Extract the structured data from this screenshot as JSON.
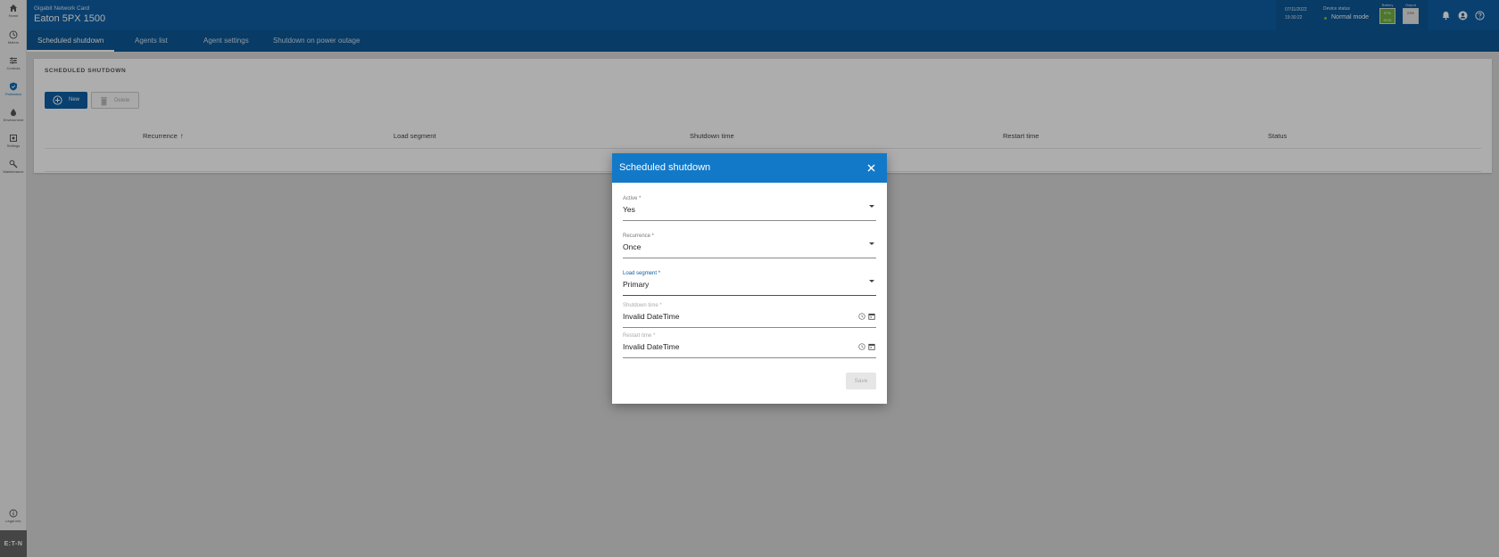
{
  "sidebar": {
    "items": [
      {
        "label": "Home",
        "icon": "home-icon"
      },
      {
        "label": "Meters",
        "icon": "meters-icon"
      },
      {
        "label": "Controls",
        "icon": "controls-icon"
      },
      {
        "label": "Protection",
        "icon": "protection-icon",
        "active": true
      },
      {
        "label": "Environment",
        "icon": "environment-icon"
      },
      {
        "label": "Settings",
        "icon": "settings-icon"
      },
      {
        "label": "Maintenance",
        "icon": "maintenance-icon"
      }
    ],
    "legal": {
      "label": "Legal info",
      "icon": "info-icon"
    },
    "brand": "E:T-N"
  },
  "header": {
    "subtitle": "Gigabit Network Card",
    "title": "Eaton 5PX 1500",
    "date": "07/11/2022",
    "time": "19:30:22",
    "device_status_label": "Device status",
    "device_status_value": "Normal mode",
    "battery": {
      "label": "Battery",
      "value": "97%",
      "sub": "00:20"
    },
    "output": {
      "label": "Output",
      "value": "23%"
    }
  },
  "tabs": [
    {
      "label": "Scheduled shutdown",
      "active": true
    },
    {
      "label": "Agents list"
    },
    {
      "label": "Agent settings"
    },
    {
      "label": "Shutdown on power outage"
    }
  ],
  "card": {
    "title": "SCHEDULED SHUTDOWN",
    "new_label": "New",
    "delete_label": "Delete",
    "columns": [
      "Recurrence",
      "Load segment",
      "Shutdown time",
      "Restart time",
      "Status"
    ],
    "sort_arrow": "↑"
  },
  "dialog": {
    "title": "Scheduled shutdown",
    "fields": {
      "active": {
        "label": "Active *",
        "value": "Yes"
      },
      "recurrence": {
        "label": "Recurrence *",
        "value": "Once"
      },
      "load_segment": {
        "label": "Load segment *",
        "value": "Primary"
      },
      "shutdown_time": {
        "label": "Shutdown time *",
        "value": "Invalid DateTime"
      },
      "restart_time": {
        "label": "Restart time *",
        "value": "Invalid DateTime"
      }
    },
    "save_label": "Save"
  },
  "colors": {
    "brand": "#0e5fa5",
    "dialog_header": "#1279c8",
    "status_ok": "#77c14b"
  }
}
